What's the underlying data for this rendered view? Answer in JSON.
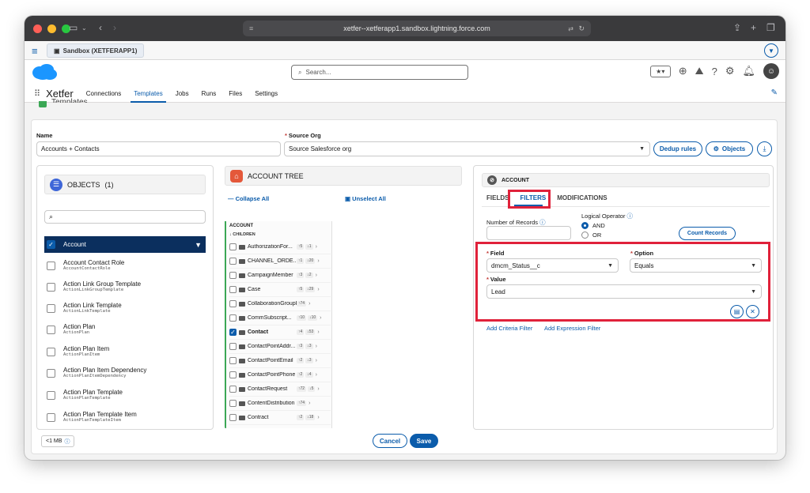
{
  "browser": {
    "url": "xetfer--xetferapp1.sandbox.lightning.force.com",
    "tab_label": "Sandbox (XETFERAPP1)",
    "colors": {
      "close": "#ff5f57",
      "minimize": "#febc2e",
      "zoom": "#28c840"
    }
  },
  "header": {
    "search_placeholder": "Search...",
    "app_name": "Xetfer",
    "nav": [
      {
        "label": "Connections"
      },
      {
        "label": "Templates"
      },
      {
        "label": "Jobs"
      },
      {
        "label": "Runs"
      },
      {
        "label": "Files"
      },
      {
        "label": "Settings"
      }
    ],
    "active_nav": "Templates",
    "page_title": "Templates"
  },
  "form": {
    "name_label": "Name",
    "name_value": "Accounts + Contacts",
    "source_org_label": "Source Org",
    "source_org_value": "Source Salesforce org",
    "dedup_label": "Dedup rules",
    "objects_label": "Objects"
  },
  "objects_panel": {
    "title": "OBJECTS",
    "count": "(1)",
    "items": [
      {
        "label": "Account",
        "api": "",
        "checked": true
      },
      {
        "label": "Account Contact Role",
        "api": "AccountContactRole",
        "checked": false
      },
      {
        "label": "Action Link Group Template",
        "api": "ActionLinkGroupTemplate",
        "checked": false
      },
      {
        "label": "Action Link Template",
        "api": "ActionLinkTemplate",
        "checked": false
      },
      {
        "label": "Action Plan",
        "api": "ActionPlan",
        "checked": false
      },
      {
        "label": "Action Plan Item",
        "api": "ActionPlanItem",
        "checked": false
      },
      {
        "label": "Action Plan Item Dependency",
        "api": "ActionPlanItemDependency",
        "checked": false
      },
      {
        "label": "Action Plan Template",
        "api": "ActionPlanTemplate",
        "checked": false
      },
      {
        "label": "Action Plan Template Item",
        "api": "ActionPlanTemplateItem",
        "checked": false
      }
    ]
  },
  "tree_panel": {
    "title": "ACCOUNT TREE",
    "collapse_all": "Collapse All",
    "unselect_all": "Unselect All",
    "root": "ACCOUNT",
    "children_label": "CHILDREN",
    "children": [
      {
        "name": "AuthorizationFor...",
        "up": "5",
        "down": "1",
        "checked": false
      },
      {
        "name": "CHANNEL_ORDE...",
        "up": "1",
        "down": "20",
        "checked": false
      },
      {
        "name": "CampaignMember",
        "up": "3",
        "down": "2",
        "checked": false
      },
      {
        "name": "Case",
        "up": "5",
        "down": "29",
        "checked": false
      },
      {
        "name": "CollaborationGroupR...",
        "up": "74",
        "down": "",
        "checked": false
      },
      {
        "name": "CommSubscript...",
        "up": "10",
        "down": "10",
        "checked": false
      },
      {
        "name": "Contact",
        "up": "4",
        "down": "53",
        "checked": true
      },
      {
        "name": "ContactPointAddr...",
        "up": "3",
        "down": "3",
        "checked": false
      },
      {
        "name": "ContactPointEmail",
        "up": "2",
        "down": "3",
        "checked": false
      },
      {
        "name": "ContactPointPhone",
        "up": "2",
        "down": "4",
        "checked": false
      },
      {
        "name": "ContactRequest",
        "up": "72",
        "down": "5",
        "checked": false
      },
      {
        "name": "ContentDistribution",
        "up": "74",
        "down": "",
        "checked": false
      },
      {
        "name": "Contract",
        "up": "2",
        "down": "18",
        "checked": false
      }
    ]
  },
  "account_panel": {
    "title": "ACCOUNT",
    "tabs": [
      {
        "label": "FIELDS"
      },
      {
        "label": "FILTERS"
      },
      {
        "label": "MODIFICATIONS"
      }
    ],
    "active_tab": "FILTERS",
    "number_of_records_label": "Number of Records",
    "logical_operator_label": "Logical Operator",
    "op_and": "AND",
    "op_or": "OR",
    "selected_operator": "AND",
    "count_records": "Count Records",
    "field_label": "Field",
    "field_value": "dmcm_Status__c",
    "option_label": "Option",
    "option_value": "Equals",
    "value_label": "Value",
    "value_value": "Lead",
    "add_criteria": "Add Criteria Filter",
    "add_expression": "Add Expression Filter"
  },
  "footer": {
    "size": "<1 MB",
    "cancel": "Cancel",
    "save": "Save"
  },
  "accent": "#0b5cab",
  "highlight": "#e0213a"
}
